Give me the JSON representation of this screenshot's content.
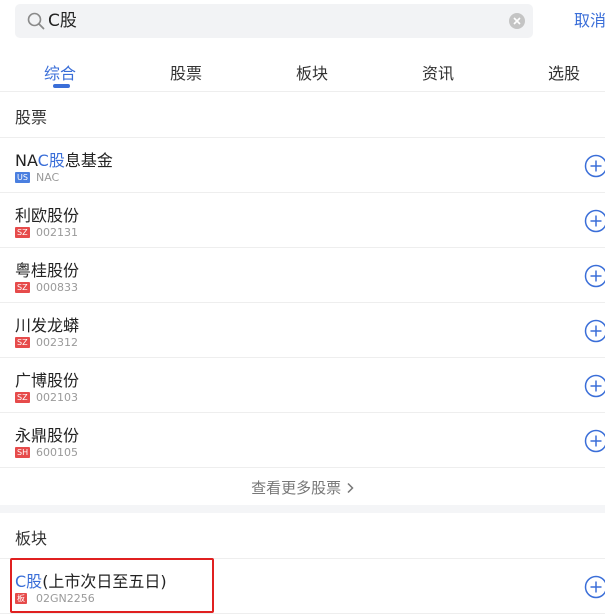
{
  "search": {
    "query": "C股",
    "cancel_label": "取消"
  },
  "tabs": [
    {
      "label": "综合",
      "active": true
    },
    {
      "label": "股票",
      "active": false
    },
    {
      "label": "板块",
      "active": false
    },
    {
      "label": "资讯",
      "active": false
    },
    {
      "label": "选股",
      "active": false
    }
  ],
  "stocks_section": {
    "title": "股票",
    "items": [
      {
        "name_pre": "NA",
        "name_hl": "C股",
        "name_post": "息基金",
        "market": "US",
        "code": "NAC"
      },
      {
        "name_pre": "利欧",
        "name_hl": "",
        "name_post": "股份",
        "market": "SZ",
        "code": "002131"
      },
      {
        "name_pre": "粤桂",
        "name_hl": "",
        "name_post": "股份",
        "market": "SZ",
        "code": "000833"
      },
      {
        "name_pre": "川发龙蟒",
        "name_hl": "",
        "name_post": "",
        "market": "SZ",
        "code": "002312"
      },
      {
        "name_pre": "广博",
        "name_hl": "",
        "name_post": "股份",
        "market": "SZ",
        "code": "002103"
      },
      {
        "name_pre": "永鼎",
        "name_hl": "",
        "name_post": "股份",
        "market": "SH",
        "code": "600105"
      }
    ],
    "more_label": "查看更多股票"
  },
  "sectors_section": {
    "title": "板块",
    "items": [
      {
        "name_hl": "C股",
        "name_post": "(上市次日至五日)",
        "badge": "板",
        "code": "02GN2256"
      }
    ]
  },
  "colors": {
    "accent": "#3a6ed8",
    "badge_us": "#4a7fe0",
    "badge_cn": "#e64b4b",
    "highlight_border": "#e02020"
  },
  "icons": {
    "search": "search-icon",
    "clear": "clear-icon",
    "add": "plus-circle-icon",
    "more": "chevron-right-icon"
  }
}
